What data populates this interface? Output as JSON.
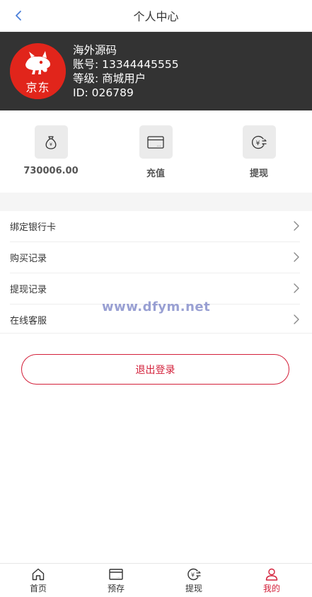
{
  "header": {
    "title": "个人中心"
  },
  "profile": {
    "avatar_text": "京东",
    "name": "海外源码",
    "account": "账号: 13344445555",
    "level": "等级: 商城用户",
    "id": "ID: 026789"
  },
  "quick_actions": [
    {
      "label": "730006.00",
      "icon": "money-bag-icon"
    },
    {
      "label": "充值",
      "icon": "wallet-icon"
    },
    {
      "label": "提现",
      "icon": "yuan-exchange-icon"
    }
  ],
  "menu": [
    {
      "label": "绑定银行卡"
    },
    {
      "label": "购买记录"
    },
    {
      "label": "提现记录"
    },
    {
      "label": "在线客服"
    }
  ],
  "watermark": "www.dfym.net",
  "logout_label": "退出登录",
  "tabbar": [
    {
      "label": "首页",
      "icon": "home-icon",
      "active": false
    },
    {
      "label": "预存",
      "icon": "wallet-icon",
      "active": false
    },
    {
      "label": "提现",
      "icon": "yuan-exchange-icon",
      "active": false
    },
    {
      "label": "我的",
      "icon": "user-icon",
      "active": true
    }
  ],
  "colors": {
    "accent": "#d3203a",
    "banner_bg": "#333333",
    "avatar_bg": "#e1251b",
    "watermark": "#8890cc"
  }
}
